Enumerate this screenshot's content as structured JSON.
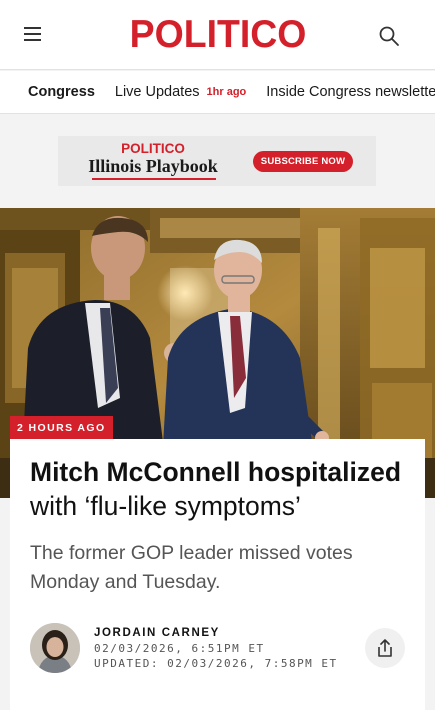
{
  "header": {
    "logo_text": "POLITICO",
    "brand_color": "#d3202a",
    "menu_icon": "hamburger-menu-icon",
    "search_icon": "search-icon"
  },
  "subnav": {
    "section": "Congress",
    "live_updates": "Live Updates",
    "live_time": "1hr ago",
    "newsletter": "Inside Congress newsletter"
  },
  "ad": {
    "brand": "POLITICO",
    "title": "Illinois Playbook",
    "cta": "SUBSCRIBE NOW",
    "cta_color": "#d3202a"
  },
  "article": {
    "badge": "2 HOURS AGO",
    "badge_color": "#d3202a",
    "headline_bold": "Mitch McConnell hospitalized",
    "headline_rest": "with ‘flu-like symptoms’",
    "dek": "The former GOP leader missed votes Monday and Tuesday.",
    "author": "JORDAIN CARNEY",
    "published": "02/03/2026, 6:51PM ET",
    "updated": "UPDATED: 02/03/2026, 7:58PM ET",
    "share_icon": "share-icon"
  }
}
